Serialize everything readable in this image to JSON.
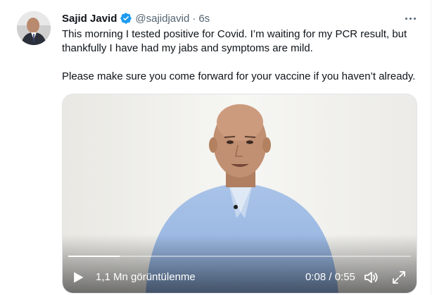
{
  "tweet": {
    "author_name": "Sajid Javid",
    "author_handle": "@sajidjavid",
    "separator": "·",
    "time_ago": "6s",
    "verified": true,
    "paragraphs": [
      "This morning I tested positive for Covid. I’m waiting for my PCR result, but thankfully I have had my jabs and symptoms are mild.",
      "Please make sure you come forward for your vaccine if you haven’t already."
    ]
  },
  "video": {
    "views_label": "1,1 Mn görüntülenme",
    "time_readout": "0:08 / 0:55",
    "progress_fraction": 0.15
  },
  "icons": {
    "verified": "verified-badge-icon",
    "more": "more-options-icon",
    "play": "play-icon",
    "volume": "volume-icon",
    "fullscreen": "fullscreen-icon"
  },
  "colors": {
    "verified_blue": "#1d9bf0",
    "secondary_text": "#536471",
    "primary_text": "#0f1419"
  }
}
